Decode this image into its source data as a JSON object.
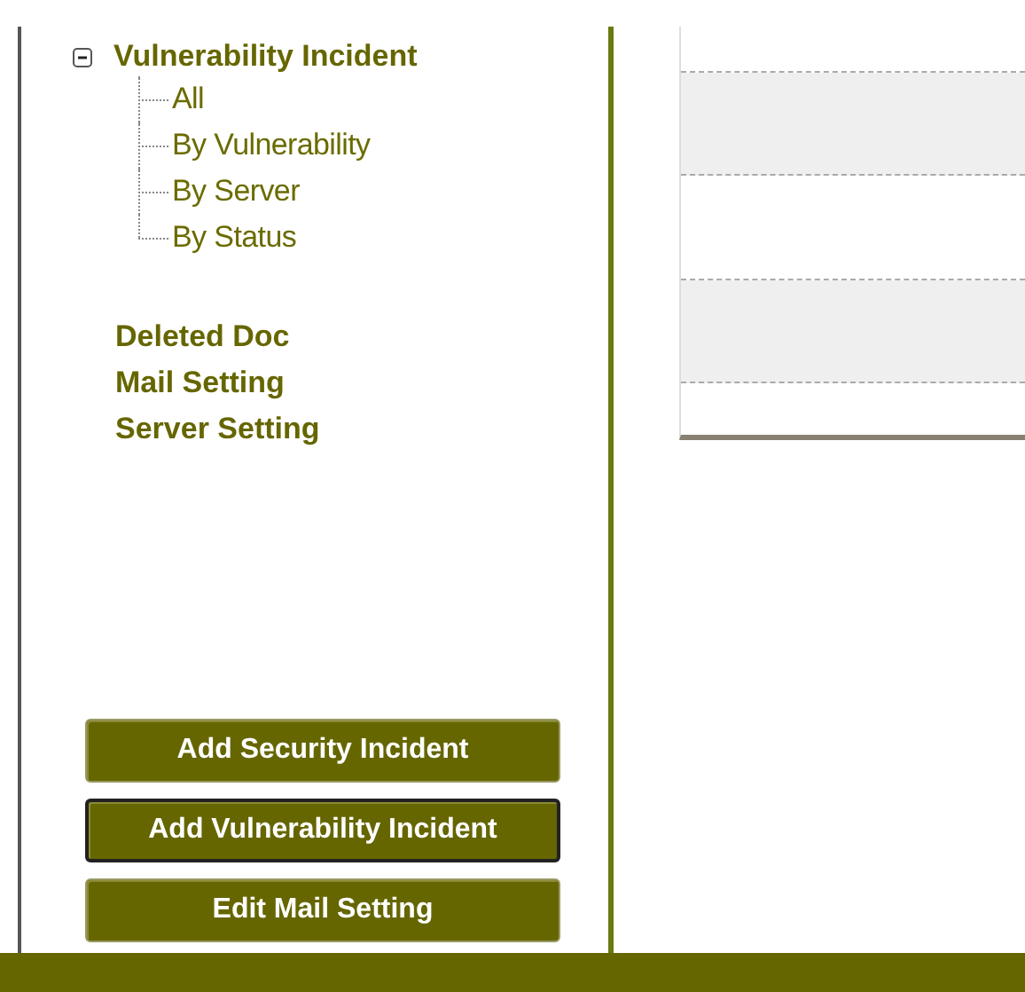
{
  "sidebar": {
    "tree": {
      "label": "Vulnerability Incident",
      "expanded": true,
      "children": [
        {
          "label": "All"
        },
        {
          "label": "By Vulnerability"
        },
        {
          "label": "By Server"
        },
        {
          "label": "By Status"
        }
      ]
    },
    "links": [
      "Deleted Doc",
      "Mail Setting",
      "Server Setting"
    ],
    "buttons": [
      {
        "label": "Add Security Incident",
        "selected": false
      },
      {
        "label": "Add Vulnerability Incident",
        "selected": true
      },
      {
        "label": "Edit Mail Setting",
        "selected": false
      }
    ]
  }
}
